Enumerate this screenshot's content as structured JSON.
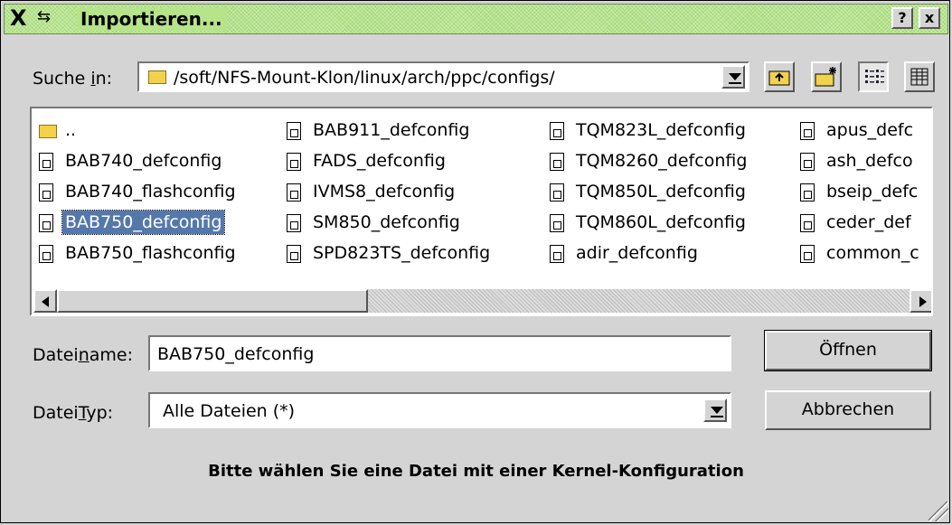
{
  "window": {
    "title": "Importieren...",
    "help_button": "?",
    "close_button": "x"
  },
  "lookin": {
    "label_pre": "Suche ",
    "label_accel": "i",
    "label_post": "n:",
    "path": "/soft/NFS-Mount-Klon/linux/arch/ppc/configs/"
  },
  "toolbar": {
    "icons": [
      "parent-directory-icon",
      "new-folder-icon",
      "list-view-icon",
      "detail-view-icon"
    ]
  },
  "files": {
    "columns": [
      [
        {
          "name": "..",
          "type": "folder"
        },
        {
          "name": "BAB740_defconfig",
          "type": "file"
        },
        {
          "name": "BAB740_flashconfig",
          "type": "file"
        },
        {
          "name": "BAB750_defconfig",
          "type": "file",
          "selected": true
        },
        {
          "name": "BAB750_flashconfig",
          "type": "file"
        }
      ],
      [
        {
          "name": "BAB911_defconfig",
          "type": "file"
        },
        {
          "name": "FADS_defconfig",
          "type": "file"
        },
        {
          "name": "IVMS8_defconfig",
          "type": "file"
        },
        {
          "name": "SM850_defconfig",
          "type": "file"
        },
        {
          "name": "SPD823TS_defconfig",
          "type": "file"
        }
      ],
      [
        {
          "name": "TQM823L_defconfig",
          "type": "file"
        },
        {
          "name": "TQM8260_defconfig",
          "type": "file"
        },
        {
          "name": "TQM850L_defconfig",
          "type": "file"
        },
        {
          "name": "TQM860L_defconfig",
          "type": "file"
        },
        {
          "name": "adir_defconfig",
          "type": "file"
        }
      ],
      [
        {
          "name": "apus_defc",
          "type": "file"
        },
        {
          "name": "ash_defco",
          "type": "file"
        },
        {
          "name": "bseip_defc",
          "type": "file"
        },
        {
          "name": "ceder_def",
          "type": "file"
        },
        {
          "name": "common_c",
          "type": "file"
        }
      ]
    ]
  },
  "filename": {
    "label_pre": "Datei",
    "label_accel": "n",
    "label_post": "ame:",
    "value": "BAB750_defconfig"
  },
  "filetype": {
    "label_pre": "Datei",
    "label_accel": "T",
    "label_post": "yp:",
    "value": "Alle Dateien (*)"
  },
  "buttons": {
    "open": "Öffnen",
    "cancel": "Abbrechen"
  },
  "hint": "Bitte wählen Sie eine Datei mit einer Kernel-Konfiguration"
}
